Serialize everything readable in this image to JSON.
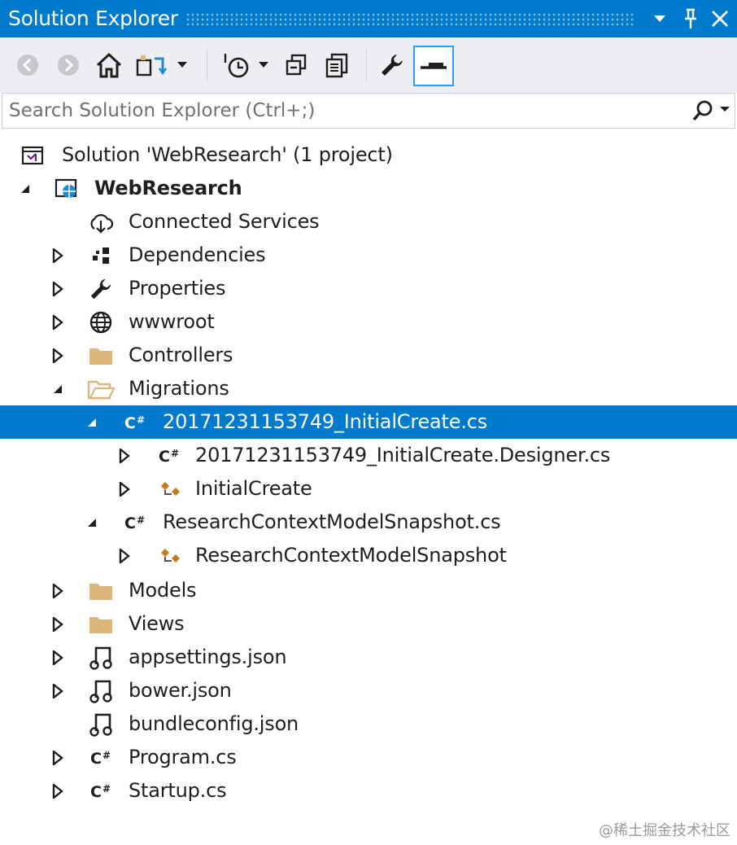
{
  "window": {
    "title": "Solution Explorer"
  },
  "toolbar": {
    "buttons": [
      {
        "name": "back-icon"
      },
      {
        "name": "forward-icon"
      },
      {
        "name": "home-icon"
      },
      {
        "name": "switch-views-icon"
      },
      {
        "name": "pending-changes-filter-icon"
      },
      {
        "name": "collapse-all-icon"
      },
      {
        "name": "show-all-files-icon"
      },
      {
        "name": "properties-wrench-icon"
      },
      {
        "name": "preview-selected-items-icon"
      }
    ]
  },
  "search": {
    "placeholder": "Search Solution Explorer (Ctrl+;)"
  },
  "tree": {
    "solution": "Solution 'WebResearch' (1 project)",
    "project": "WebResearch",
    "connected_services": "Connected Services",
    "dependencies": "Dependencies",
    "properties": "Properties",
    "wwwroot": "wwwroot",
    "controllers": "Controllers",
    "migrations": "Migrations",
    "initial_create_cs": "20171231153749_InitialCreate.cs",
    "initial_create_designer": "20171231153749_InitialCreate.Designer.cs",
    "initial_create_class": "InitialCreate",
    "snapshot_cs": "ResearchContextModelSnapshot.cs",
    "snapshot_class": "ResearchContextModelSnapshot",
    "models": "Models",
    "views": "Views",
    "appsettings": "appsettings.json",
    "bower": "bower.json",
    "bundleconfig": "bundleconfig.json",
    "program": "Program.cs",
    "startup": "Startup.cs"
  },
  "colors": {
    "accent": "#007acc",
    "toolbar_bg": "#eeeef2",
    "folder": "#dcb67a"
  },
  "watermark": "@稀土掘金技术社区"
}
